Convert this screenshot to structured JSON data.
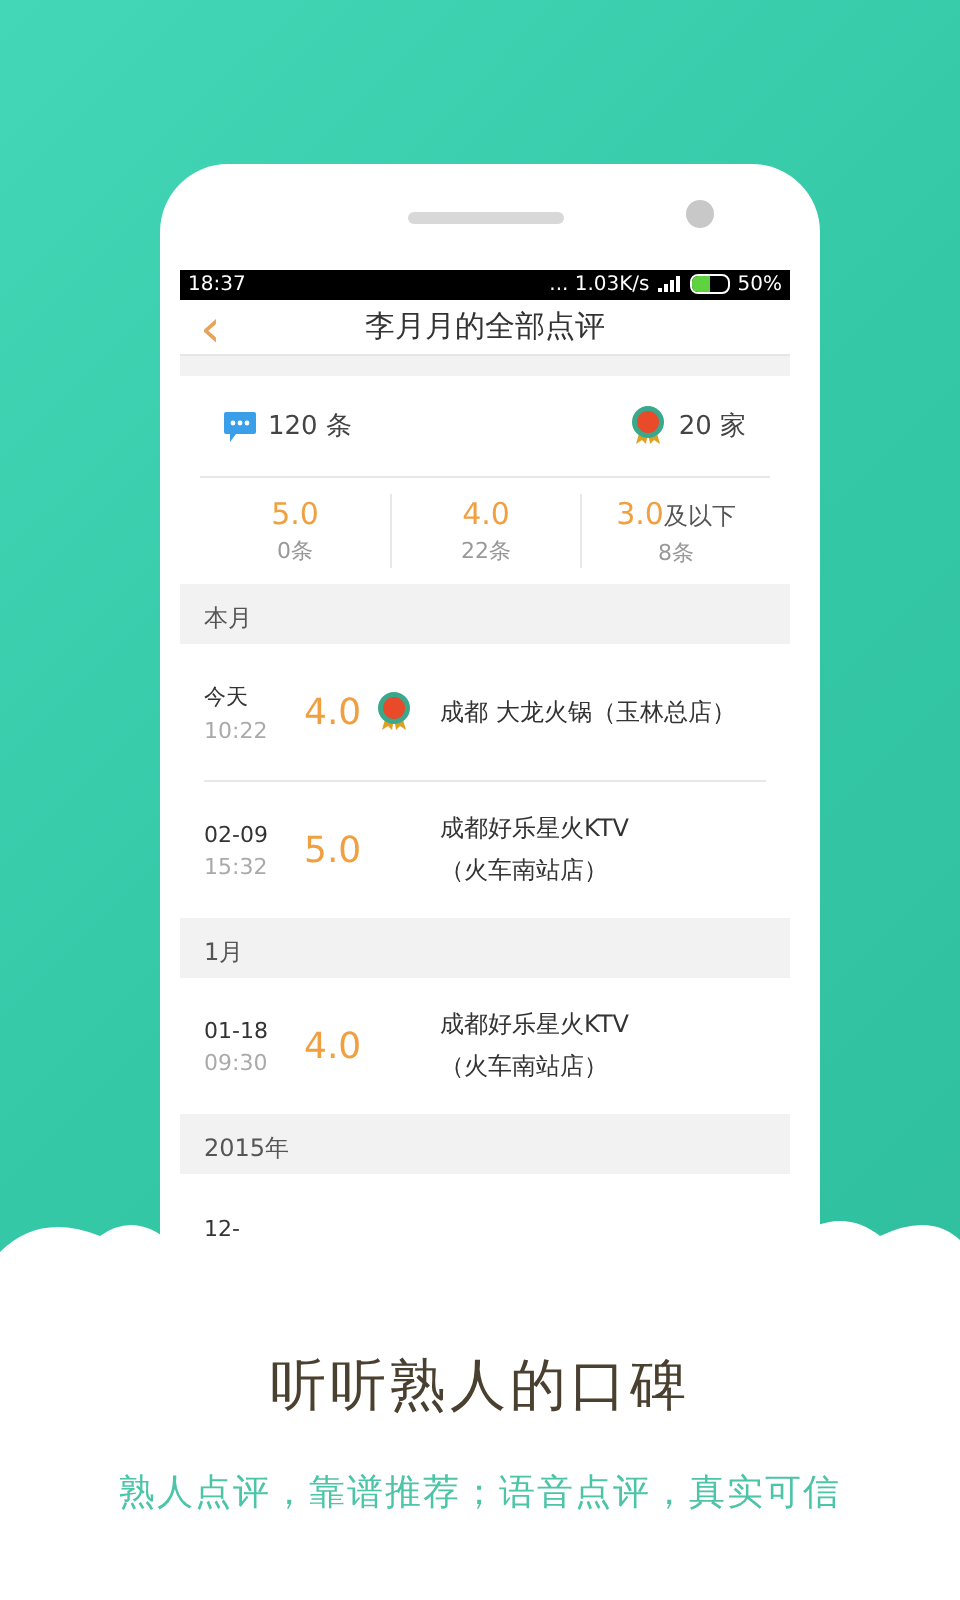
{
  "status_bar": {
    "time": "18:37",
    "speed": "... 1.03K/s",
    "battery": "50%"
  },
  "header": {
    "back": "‹",
    "title": "李月月的全部点评"
  },
  "summary": {
    "reviews": "120 条",
    "shops": "20 家",
    "scores": [
      {
        "score": "5.0",
        "count": "0条"
      },
      {
        "score": "4.0",
        "count": "22条"
      },
      {
        "score": "3.0",
        "suffix": "及以下",
        "count": "8条"
      }
    ]
  },
  "sections": [
    {
      "title": "本月",
      "rows": [
        {
          "date": "今天",
          "time": "10:22",
          "score": "4.0",
          "medal": true,
          "shop_lines": [
            "成都 大龙火锅（玉林总店）"
          ]
        },
        {
          "date": "02-09",
          "time": "15:32",
          "score": "5.0",
          "medal": false,
          "shop_lines": [
            "成都好乐星火KTV",
            "（火车南站店）"
          ]
        }
      ]
    },
    {
      "title": "1月",
      "rows": [
        {
          "date": "01-18",
          "time": "09:30",
          "score": "4.0",
          "medal": false,
          "shop_lines": [
            "成都好乐星火KTV",
            "（火车南站店）"
          ]
        }
      ]
    },
    {
      "title": "2015年",
      "rows": [
        {
          "date": "12-"
        }
      ]
    }
  ],
  "caption": {
    "headline": "听听熟人的口碑",
    "subline": "熟人点评，靠谱推荐；语音点评，真实可信"
  }
}
